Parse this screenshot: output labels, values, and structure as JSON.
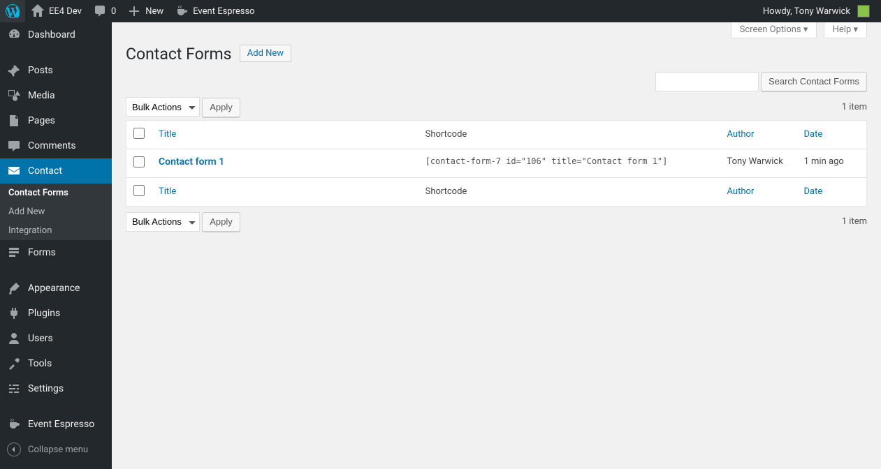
{
  "adminbar": {
    "site_name": "EE4 Dev",
    "comments_count": "0",
    "new_label": "New",
    "ee_label": "Event Espresso",
    "howdy": "Howdy, Tony Warwick"
  },
  "menu": {
    "dashboard": "Dashboard",
    "posts": "Posts",
    "media": "Media",
    "pages": "Pages",
    "comments": "Comments",
    "contact": "Contact",
    "contact_sub": {
      "contact_forms": "Contact Forms",
      "add_new": "Add New",
      "integration": "Integration"
    },
    "forms": "Forms",
    "appearance": "Appearance",
    "plugins": "Plugins",
    "users": "Users",
    "tools": "Tools",
    "settings": "Settings",
    "event_espresso": "Event Espresso",
    "collapse": "Collapse menu"
  },
  "screen_meta": {
    "screen_options": "Screen Options",
    "help": "Help"
  },
  "page": {
    "title": "Contact Forms",
    "add_new": "Add New",
    "search_button": "Search Contact Forms",
    "bulk_actions": "Bulk Actions",
    "apply": "Apply",
    "items_count": "1 item"
  },
  "table": {
    "columns": {
      "title": "Title",
      "shortcode": "Shortcode",
      "author": "Author",
      "date": "Date"
    },
    "rows": [
      {
        "title": "Contact form 1",
        "shortcode": "[contact-form-7 id=\"106\" title=\"Contact form 1\"]",
        "author": "Tony Warwick",
        "date": "1 min ago"
      }
    ]
  }
}
